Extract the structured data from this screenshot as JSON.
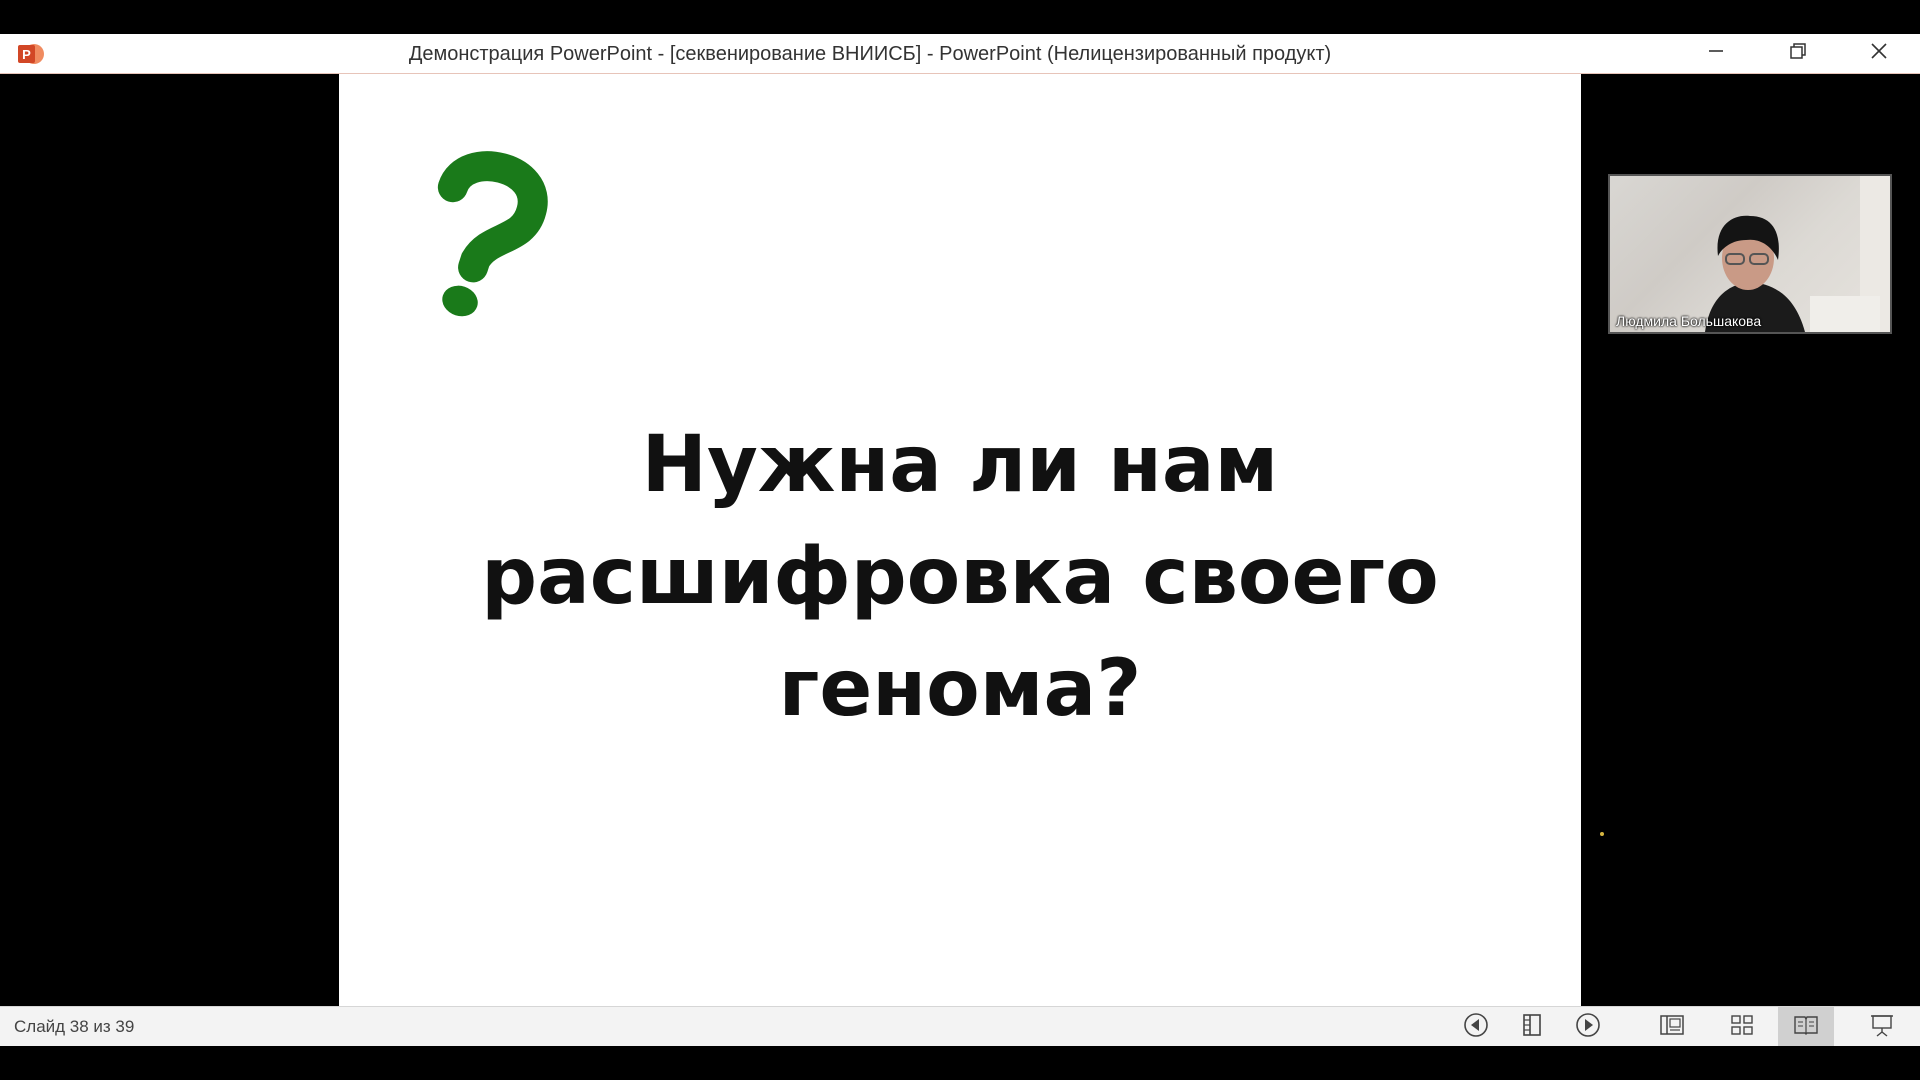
{
  "window": {
    "title": "Демонстрация PowerPoint - [секвенирование ВНИИСБ] - PowerPoint (Нелицензированный продукт)",
    "app_icon": "powerpoint-icon",
    "accent_color": "#d24726",
    "controls": {
      "minimize_icon": "minimize-icon",
      "restore_icon": "restore-icon",
      "close_icon": "close-icon"
    }
  },
  "slide": {
    "decoration_icon": "question-mark-icon",
    "decoration_color": "#1a7a1a",
    "title_lines": [
      "Нужна ли нам",
      "расшифровка своего",
      "генома?"
    ]
  },
  "video": {
    "participant_name": "Людмила Большакова"
  },
  "status_bar": {
    "slide_counter": "Слайд 38 из 39",
    "buttons": [
      {
        "name": "previous-slide-button",
        "icon": "prev-circle-icon"
      },
      {
        "name": "slide-menu-button",
        "icon": "slide-menu-icon"
      },
      {
        "name": "next-slide-button",
        "icon": "next-circle-icon"
      },
      {
        "name": "normal-view-button",
        "icon": "normal-view-icon"
      },
      {
        "name": "slide-sorter-button",
        "icon": "slide-sorter-icon"
      },
      {
        "name": "reading-view-button",
        "icon": "reading-view-icon",
        "active": true
      },
      {
        "name": "slideshow-button",
        "icon": "slideshow-icon"
      }
    ]
  }
}
